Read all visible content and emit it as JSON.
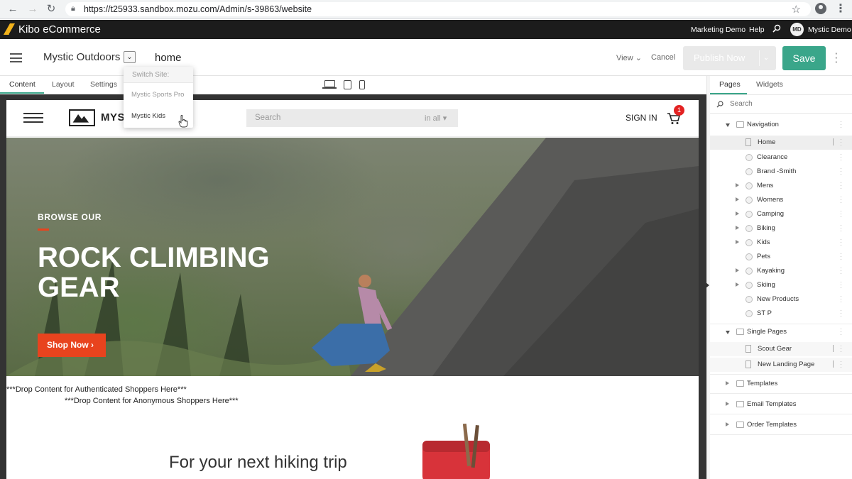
{
  "browser": {
    "url": "https://t25933.sandbox.mozu.com/Admin/s-39863/website"
  },
  "app": {
    "title": "Kibo eCommerce",
    "links": [
      "Marketing Demo",
      "Help"
    ],
    "user_initials": "MD",
    "user_name": "Mystic Demo"
  },
  "toolbar": {
    "site_name": "Mystic Outdoors",
    "page_name": "home",
    "view_label": "View",
    "cancel_label": "Cancel",
    "publish_label": "Publish Now",
    "save_label": "Save"
  },
  "content_tabs": [
    "Content",
    "Layout",
    "Settings"
  ],
  "switch_site": {
    "header": "Switch Site:",
    "items": [
      "Mystic Sports Pro",
      "Mystic Kids"
    ]
  },
  "store": {
    "brand": "MYS                  ORS",
    "search_placeholder": "Search",
    "search_scope": "in all",
    "sign_in": "SIGN IN",
    "cart_count": "1",
    "hero_kicker": "BROWSE OUR",
    "hero_title_1": "ROCK CLIMBING",
    "hero_title_2": "GEAR",
    "shop_now": "Shop Now",
    "drop_authenticated": "***Drop Content for Authenticated Shoppers Here***",
    "drop_anonymous": "***Drop Content for Anonymous Shoppers Here***",
    "hiking_heading": "For your next hiking trip"
  },
  "panel": {
    "tabs": [
      "Pages",
      "Widgets"
    ],
    "search_placeholder": "Search",
    "navigation_label": "Navigation",
    "navigation_items": [
      "Home",
      "Clearance",
      "Brand -Smith",
      "Mens",
      "Womens",
      "Camping",
      "Biking",
      "Kids",
      "Pets",
      "Kayaking",
      "Skiing",
      "New Products",
      "ST P"
    ],
    "single_pages_label": "Single Pages",
    "single_pages_items": [
      "Scout Gear",
      "New Landing Page"
    ],
    "other_folders": [
      "Templates",
      "Email Templates",
      "Order Templates"
    ]
  },
  "colors": {
    "accent": "#3aa68a",
    "cta": "#e8431e",
    "header_bg": "#1c1c1c"
  }
}
